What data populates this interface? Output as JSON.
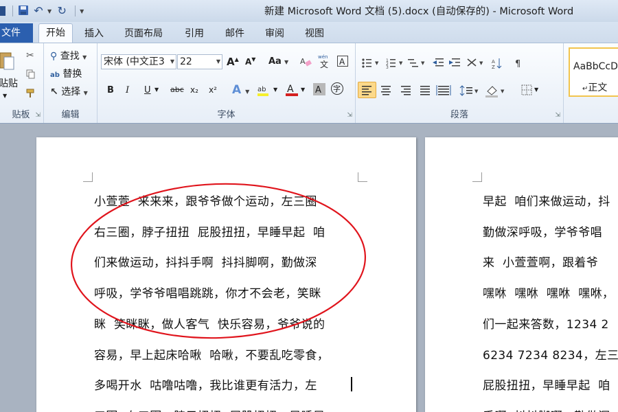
{
  "window": {
    "title": "新建 Microsoft Word 文档 (5).docx (自动保存的) - Microsoft Word"
  },
  "quick_access": {
    "save_icon": "save-icon",
    "undo_icon": "undo-icon",
    "redo_icon": "redo-icon"
  },
  "tabs": {
    "file": "文件",
    "home": "开始",
    "insert": "插入",
    "layout": "页面布局",
    "references": "引用",
    "mailings": "邮件",
    "review": "审阅",
    "view": "视图"
  },
  "ribbon": {
    "clipboard": {
      "paste": "贴贴",
      "label": "贴板"
    },
    "editing": {
      "find": "查找",
      "replace": "替换",
      "select": "选择",
      "label": "编辑"
    },
    "font": {
      "name": "宋体 (中文正文)",
      "name_display": "宋体 (中文正3",
      "size": "22",
      "label": "字体",
      "buttons": {
        "bold": "B",
        "italic": "I",
        "underline": "U",
        "strike": "abc",
        "sub": "x₂",
        "sup": "x²",
        "grow": "A",
        "shrink": "A",
        "case": "Aa",
        "text_effects": "A",
        "font_color": "A",
        "char_shade": "A",
        "enclose": "字"
      }
    },
    "paragraph": {
      "label": "段落"
    },
    "styles": {
      "sample": "AaBbCcD",
      "normal": "正文"
    }
  },
  "document": {
    "page1_lines": [
      "小萱萱  来来来，跟爷爷做个运动，左三圈",
      "右三圈，脖子扭扭  屁股扭扭，早睡早起  咱",
      "们来做运动，抖抖手啊  抖抖脚啊，勤做深",
      "呼吸，学爷爷唱唱跳跳，你才不会老，笑眯",
      "眯  笑眯眯，做人客气  快乐容易，爷爷说的",
      "容易，早上起床哈啾  哈啾，不要乱吃零食，",
      "多喝开水  咕噜咕噜，我比谁更有活力，左",
      "三圈  右三圈，脖子扭扭  屁股扭扭，早睡早"
    ],
    "page2_lines": [
      "早起  咱们来做运动，抖",
      "勤做深呼吸，学爷爷唱",
      "来  小萱萱啊，跟着爷",
      "嘿咻  嘿咻  嘿咻  嘿咻，",
      "们一起来答数，1234 2",
      "6234 7234 8234，左三",
      "屁股扭扭，早睡早起  咱",
      "手啊  抖抖脚啊，勤做深"
    ]
  },
  "colors": {
    "file_tab": "#2b5faf",
    "annotation_ellipse": "#e0141c",
    "doc_background": "#a9b3c1"
  }
}
